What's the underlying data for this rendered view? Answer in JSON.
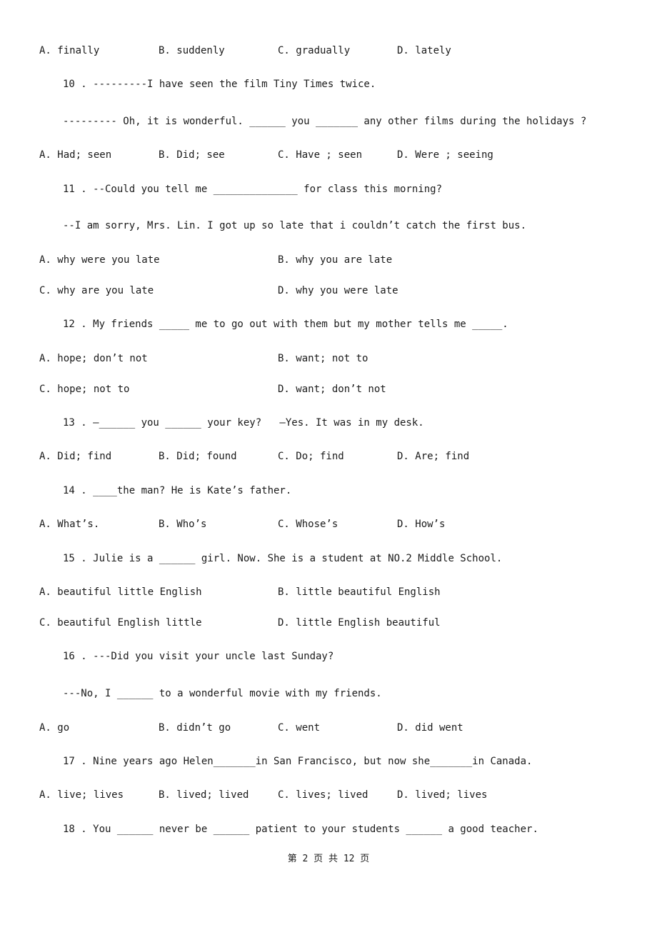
{
  "q9": {
    "options": [
      "A. finally",
      "B. suddenly",
      "C. gradually",
      "D. lately"
    ]
  },
  "q10": {
    "stem": "10 . ---------I have seen the film Tiny Times twice.",
    "stem2": "--------- Oh, it is wonderful. ______ you _______ any other films during the holidays ?",
    "options": [
      "A. Had; seen",
      "B. Did; see",
      "C. Have ; seen",
      "D. Were ; seeing"
    ]
  },
  "q11": {
    "stem": "11 . --Could you tell me ______________ for class this morning?",
    "stem2": "--I am sorry, Mrs. Lin. I got up so late that i couldn’t catch the first bus.",
    "options": [
      "A. why were you late",
      "B. why you are late",
      "C. why are you late",
      "D. why you were late"
    ]
  },
  "q12": {
    "stem": "12 . My friends _____ me to go out with them but my mother tells me _____.",
    "options": [
      "A. hope; don’t not",
      "B. want; not to",
      "C. hope; not to",
      "D. want; don’t not"
    ]
  },
  "q13": {
    "stem": "13 . —______ you ______ your key?   —Yes. It was in my desk.",
    "options": [
      "A. Did; find",
      "B. Did; found",
      "C. Do; find",
      "D. Are; find"
    ]
  },
  "q14": {
    "stem": "14 . ____the man? He is Kate’s father.",
    "options": [
      "A. What’s.",
      "B. Who’s",
      "C. Whose’s",
      "D. How’s"
    ]
  },
  "q15": {
    "stem": "15 . Julie is a ______ girl. Now. She is a student at NO.2 Middle School.",
    "options": [
      "A. beautiful little English",
      "B. little beautiful English",
      "C. beautiful English little",
      "D. little English beautiful"
    ]
  },
  "q16": {
    "stem": "16 . ---Did you visit your uncle last Sunday?",
    "stem2": "---No, I ______ to a wonderful movie with my friends.",
    "options": [
      "A. go",
      "B. didn’t go",
      "C. went",
      "D. did went"
    ]
  },
  "q17": {
    "stem": "17 . Nine years ago Helen_______in San Francisco, but now she_______in Canada.",
    "options": [
      "A. live; lives",
      "B. lived; lived",
      "C. lives; lived",
      "D. lived; lives"
    ]
  },
  "q18": {
    "stem": "18 . You ______ never be ______ patient to your students ______ a good teacher."
  },
  "footer": {
    "page_label": "第 2 页 共 12 页"
  }
}
